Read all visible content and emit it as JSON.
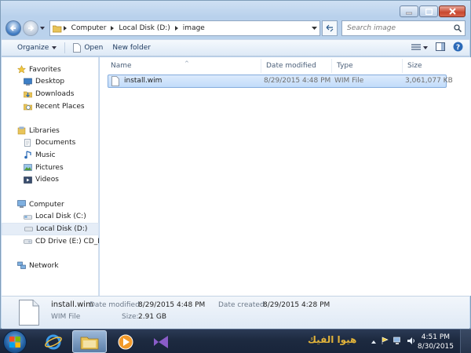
{
  "address_bar": {
    "crumbs": [
      "Computer",
      "Local Disk (D:)",
      "image"
    ]
  },
  "search": {
    "placeholder": "Search image"
  },
  "toolbar": {
    "organize_label": "Organize",
    "open_label": "Open",
    "new_folder_label": "New folder"
  },
  "nav": {
    "favorites": {
      "label": "Favorites",
      "items": [
        "Desktop",
        "Downloads",
        "Recent Places"
      ]
    },
    "libraries": {
      "label": "Libraries",
      "items": [
        "Documents",
        "Music",
        "Pictures",
        "Videos"
      ]
    },
    "computer": {
      "label": "Computer",
      "items": [
        "Local Disk (C:)",
        "Local Disk (D:)",
        "CD Drive (E:) CD_RO"
      ]
    },
    "network": {
      "label": "Network"
    }
  },
  "columns": {
    "name": "Name",
    "date_modified": "Date modified",
    "type": "Type",
    "size": "Size"
  },
  "files": [
    {
      "name": "install.wim",
      "date_modified": "8/29/2015 4:48 PM",
      "type": "WIM File",
      "size": "3,061,077 KB"
    }
  ],
  "details": {
    "filename": "install.wim",
    "filetype": "WIM File",
    "date_modified_label": "Date modified:",
    "date_modified": "8/29/2015 4:48 PM",
    "date_created_label": "Date created:",
    "date_created": "8/29/2015 4:28 PM",
    "size_label": "Size:",
    "size": "2.91 GB"
  },
  "taskbar": {
    "watermark": "هيوا الفيك",
    "time": "4:51 PM",
    "date": "8/30/2015"
  },
  "colors": {
    "selection": "#c2dcfa",
    "taskbar": "#1d2a40",
    "window_frame": "#b9d1ec"
  }
}
